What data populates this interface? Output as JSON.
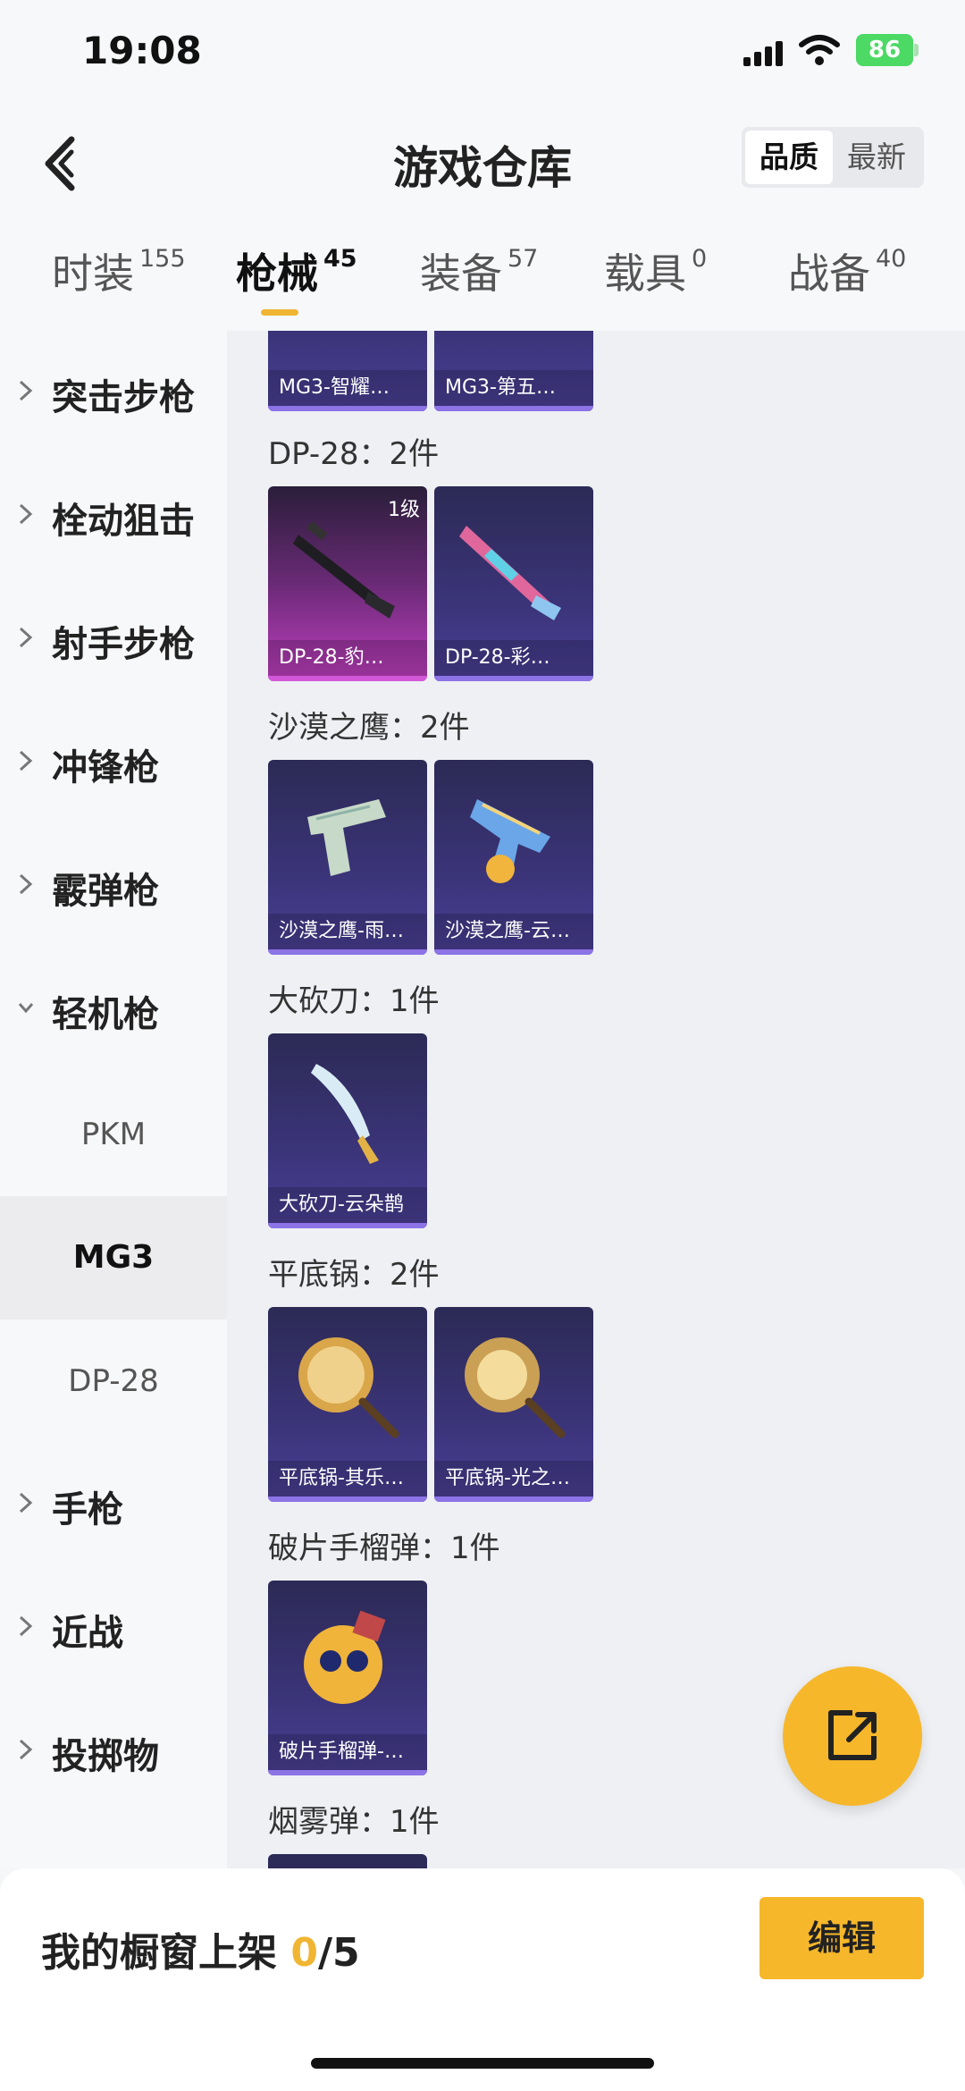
{
  "status_bar": {
    "time": "19:08",
    "battery": "86"
  },
  "header": {
    "title": "游戏仓库",
    "sort_options": [
      "品质",
      "最新"
    ],
    "active_sort": "品质"
  },
  "tabs": [
    {
      "label": "时装",
      "count": "155"
    },
    {
      "label": "枪械",
      "count": "45",
      "active": true
    },
    {
      "label": "装备",
      "count": "57"
    },
    {
      "label": "载具",
      "count": "0"
    },
    {
      "label": "战备",
      "count": "40"
    }
  ],
  "sidebar": {
    "categories": [
      {
        "label": "突击步枪",
        "expanded": false
      },
      {
        "label": "栓动狙击",
        "expanded": false
      },
      {
        "label": "射手步枪",
        "expanded": false
      },
      {
        "label": "冲锋枪",
        "expanded": false
      },
      {
        "label": "霰弹枪",
        "expanded": false
      },
      {
        "label": "轻机枪",
        "expanded": true
      },
      {
        "label": "手枪",
        "expanded": false
      },
      {
        "label": "近战",
        "expanded": false
      },
      {
        "label": "投掷物",
        "expanded": false
      }
    ],
    "sub_items": [
      {
        "label": "PKM"
      },
      {
        "label": "MG3",
        "active": true
      },
      {
        "label": "DP-28"
      }
    ]
  },
  "main": {
    "top_cards": [
      "MG3-智耀…",
      "MG3-第五…"
    ],
    "groups": [
      {
        "title": "DP-28：2件",
        "cards": [
          {
            "name": "DP-28-豹…",
            "level": "1级"
          },
          {
            "name": "DP-28-彩…"
          }
        ]
      },
      {
        "title": "沙漠之鹰：2件",
        "cards": [
          {
            "name": "沙漠之鹰-雨…"
          },
          {
            "name": "沙漠之鹰-云…"
          }
        ]
      },
      {
        "title": "大砍刀：1件",
        "cards": [
          {
            "name": "大砍刀-云朵鹊"
          }
        ]
      },
      {
        "title": "平底锅：2件",
        "cards": [
          {
            "name": "平底锅-其乐…"
          },
          {
            "name": "平底锅-光之…"
          }
        ]
      },
      {
        "title": "破片手榴弹：1件",
        "cards": [
          {
            "name": "破片手榴弹-…"
          }
        ]
      },
      {
        "title": "烟雾弹：1件",
        "cards": []
      }
    ]
  },
  "bottom": {
    "showcase_prefix": "我的橱窗上架 ",
    "showcase_count": "0",
    "showcase_total": "/5",
    "edit_label": "编辑"
  },
  "colors": {
    "accent": "#f6b72b",
    "card_bg": "#3b3479",
    "card_stripe": "#8c73e6"
  }
}
